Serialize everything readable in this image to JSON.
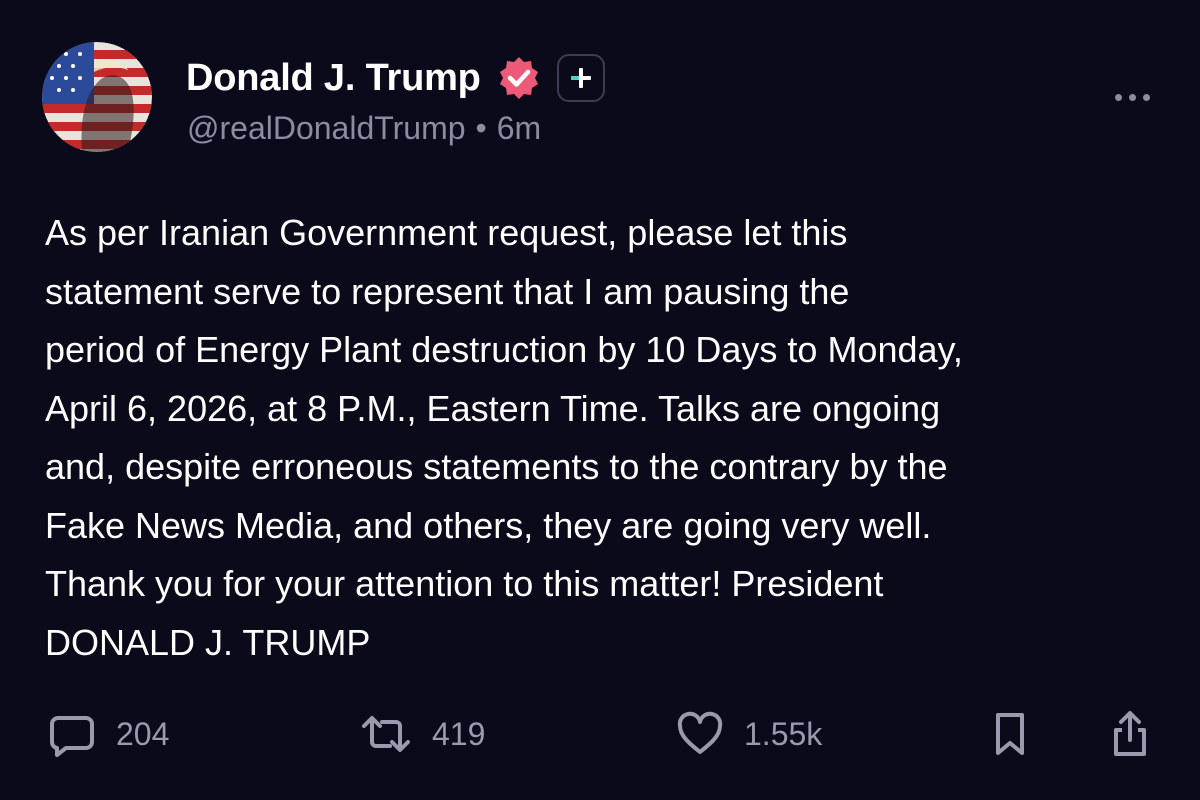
{
  "author": {
    "display_name": "Donald J. Trump",
    "handle": "@realDonaldTrump",
    "separator": "•",
    "time_ago": "6m",
    "verified_color": "#ec5a78",
    "avatar_icon": "flag-portrait-avatar"
  },
  "post": {
    "text": "As per Iranian Government request, please let this\nstatement serve to represent that I am pausing the\nperiod of Energy Plant destruction by 10 Days to Monday,\nApril 6, 2026, at 8 P.M., Eastern Time. Talks are ongoing\nand, despite erroneous statements to the contrary by the\nFake News Media, and others, they are going very well.\nThank you for your attention to this matter! President\nDONALD J. TRUMP"
  },
  "actions": {
    "replies": "204",
    "retruths": "419",
    "likes": "1.55k"
  },
  "icons": {
    "reply": "comment-icon",
    "retruth": "repost-icon",
    "like": "heart-icon",
    "bookmark": "bookmark-icon",
    "share": "share-icon",
    "more": "more-dots-icon",
    "plus": "plus-badge-icon"
  },
  "colors": {
    "background": "#0a0a1a",
    "text": "#ffffff",
    "muted": "#8c8ca0",
    "accent_teal": "#4fd1c5"
  }
}
